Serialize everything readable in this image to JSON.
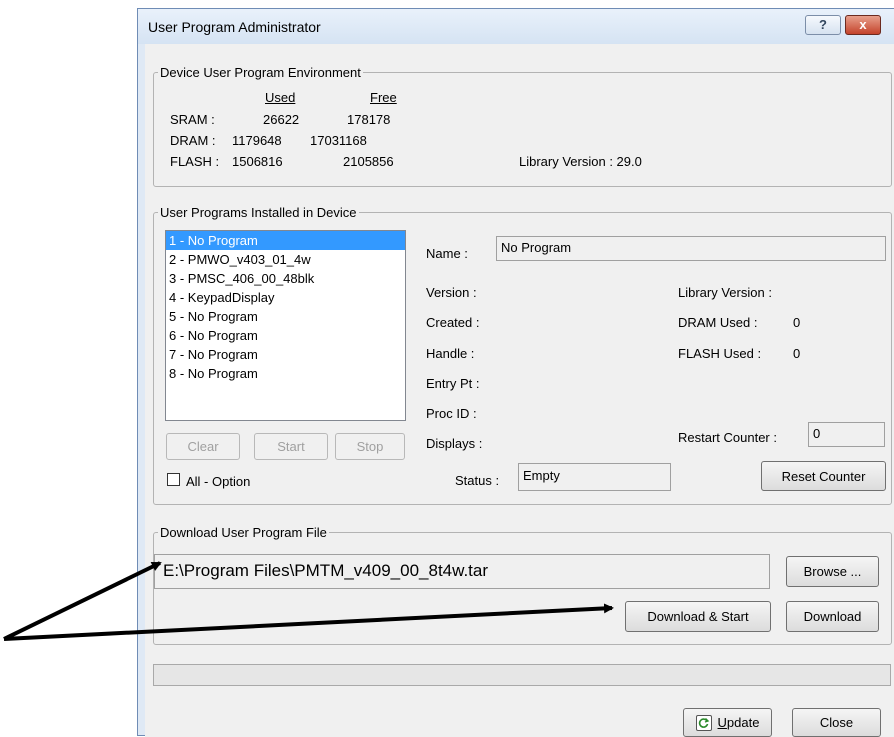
{
  "window": {
    "title": "User Program Administrator",
    "help_glyph": "?",
    "close_glyph": "x"
  },
  "env": {
    "legend": "Device User Program Environment",
    "used_header": "Used",
    "free_header": "Free",
    "rows": [
      {
        "label": "SRAM :",
        "used": "26622",
        "free": "178178"
      },
      {
        "label": "DRAM :",
        "used": "1179648",
        "free": "17031168"
      },
      {
        "label": "FLASH :",
        "used": "1506816",
        "free": "2105856"
      }
    ],
    "library_version": "Library Version : 29.0"
  },
  "programs": {
    "legend": "User Programs Installed in Device",
    "items": [
      "1 - No Program",
      "2 - PMWO_v403_01_4w",
      "3 - PMSC_406_00_48blk",
      "4 - KeypadDisplay",
      "5 - No Program",
      "6 - No Program",
      "7 - No Program",
      "8 - No Program"
    ],
    "selected_index": 0,
    "clear_label": "Clear",
    "start_label": "Start",
    "stop_label": "Stop",
    "all_option_label": "All - Option",
    "all_option_checked": false,
    "name_label": "Name :",
    "name_value": "No Program",
    "version_label": "Version :",
    "created_label": "Created :",
    "handle_label": "Handle :",
    "entry_label": "Entry Pt :",
    "proc_label": "Proc ID :",
    "displays_label": "Displays :",
    "lib_version_label": "Library Version :",
    "dram_used_label": "DRAM Used :",
    "dram_used_value": "0",
    "flash_used_label": "FLASH Used :",
    "flash_used_value": "0",
    "restart_label": "Restart Counter :",
    "restart_value": "0",
    "status_label": "Status :",
    "status_value": "Empty",
    "reset_label": "Reset Counter"
  },
  "download": {
    "legend": "Download User Program File",
    "path_value": "E:\\Program Files\\PMTM_v409_00_8t4w.tar",
    "browse_label": "Browse ...",
    "download_start_label": "Download & Start",
    "download_label": "Download"
  },
  "footer": {
    "update_mnemonic": "U",
    "update_rest": "pdate",
    "close_label": "Close"
  },
  "annotation": {
    "arrow_color": "#000000"
  }
}
